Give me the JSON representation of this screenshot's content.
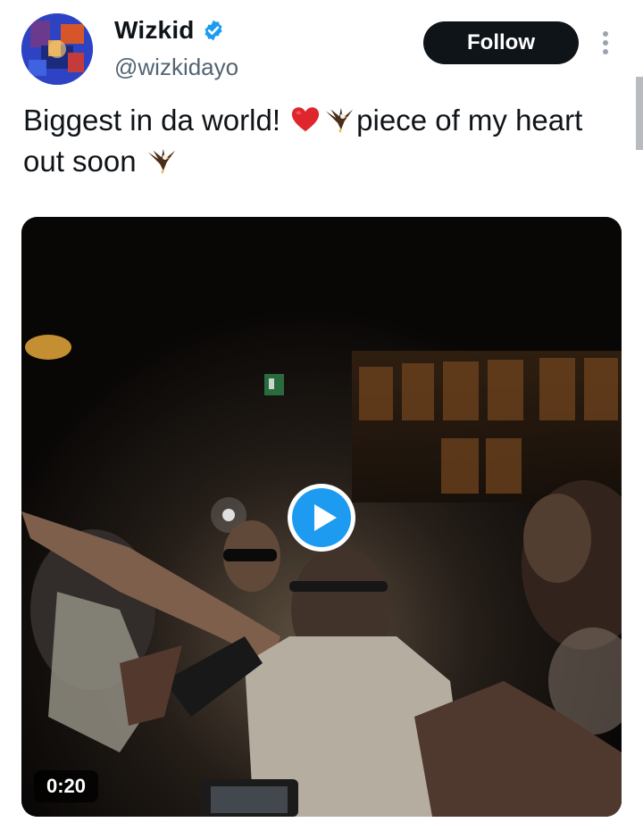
{
  "author": {
    "display_name": "Wizkid",
    "handle": "@wizkidayo",
    "verified": true,
    "verified_color": "#1d9bf0"
  },
  "actions": {
    "follow_label": "Follow",
    "more_icon": "more-vertical-icon"
  },
  "tweet": {
    "text_part1": "Biggest in da world! ",
    "text_part2": "piece of my heart out soon ",
    "emojis": [
      "red-heart",
      "eagle",
      "eagle"
    ]
  },
  "media": {
    "type": "video",
    "duration": "0:20",
    "play_icon": "play-icon",
    "accent": "#1d9bf0"
  }
}
